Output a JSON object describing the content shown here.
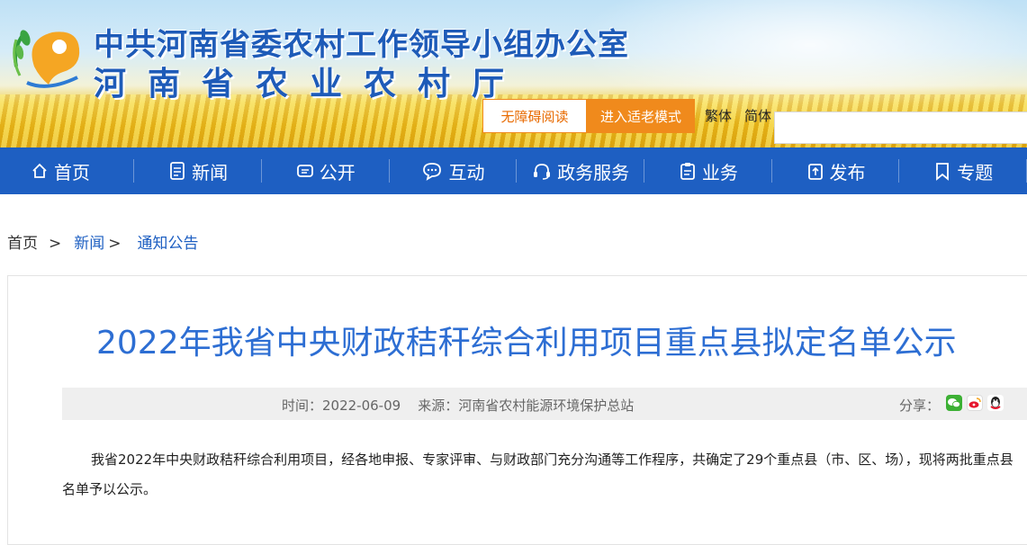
{
  "header": {
    "title_line1": "中共河南省委农村工作领导小组办公室",
    "title_line2": "河南省农业农村厅",
    "accessibility_label": "无障碍阅读",
    "elder_mode_label": "进入适老模式",
    "traditional_label": "繁体",
    "simplified_label": "简体"
  },
  "nav": {
    "items": [
      {
        "label": "首页",
        "icon": "home-icon"
      },
      {
        "label": "新闻",
        "icon": "news-icon"
      },
      {
        "label": "公开",
        "icon": "message-icon"
      },
      {
        "label": "互动",
        "icon": "chat-icon"
      },
      {
        "label": "政务服务",
        "icon": "headset-icon"
      },
      {
        "label": "业务",
        "icon": "clipboard-icon"
      },
      {
        "label": "发布",
        "icon": "upload-icon"
      },
      {
        "label": "专题",
        "icon": "bookmark-icon"
      }
    ]
  },
  "breadcrumb": {
    "home": "首页",
    "sep1": ">",
    "news": "新闻",
    "sep2": ">",
    "current": "通知公告"
  },
  "article": {
    "title": "2022年我省中央财政秸秆综合利用项目重点县拟定名单公示",
    "meta": "时间：2022-06-09    来源：河南省农村能源环境保护总站",
    "share_label": "分享：",
    "body": "我省2022年中央财政秸秆综合利用项目，经各地申报、专家评审、与财政部门充分沟通等工作程序，共确定了29个重点县（市、区、场），现将两批重点县名单予以公示。"
  },
  "colors": {
    "nav_bg": "#1e5fc2",
    "title_blue": "#2d6ed3",
    "orange": "#f08a1c"
  }
}
